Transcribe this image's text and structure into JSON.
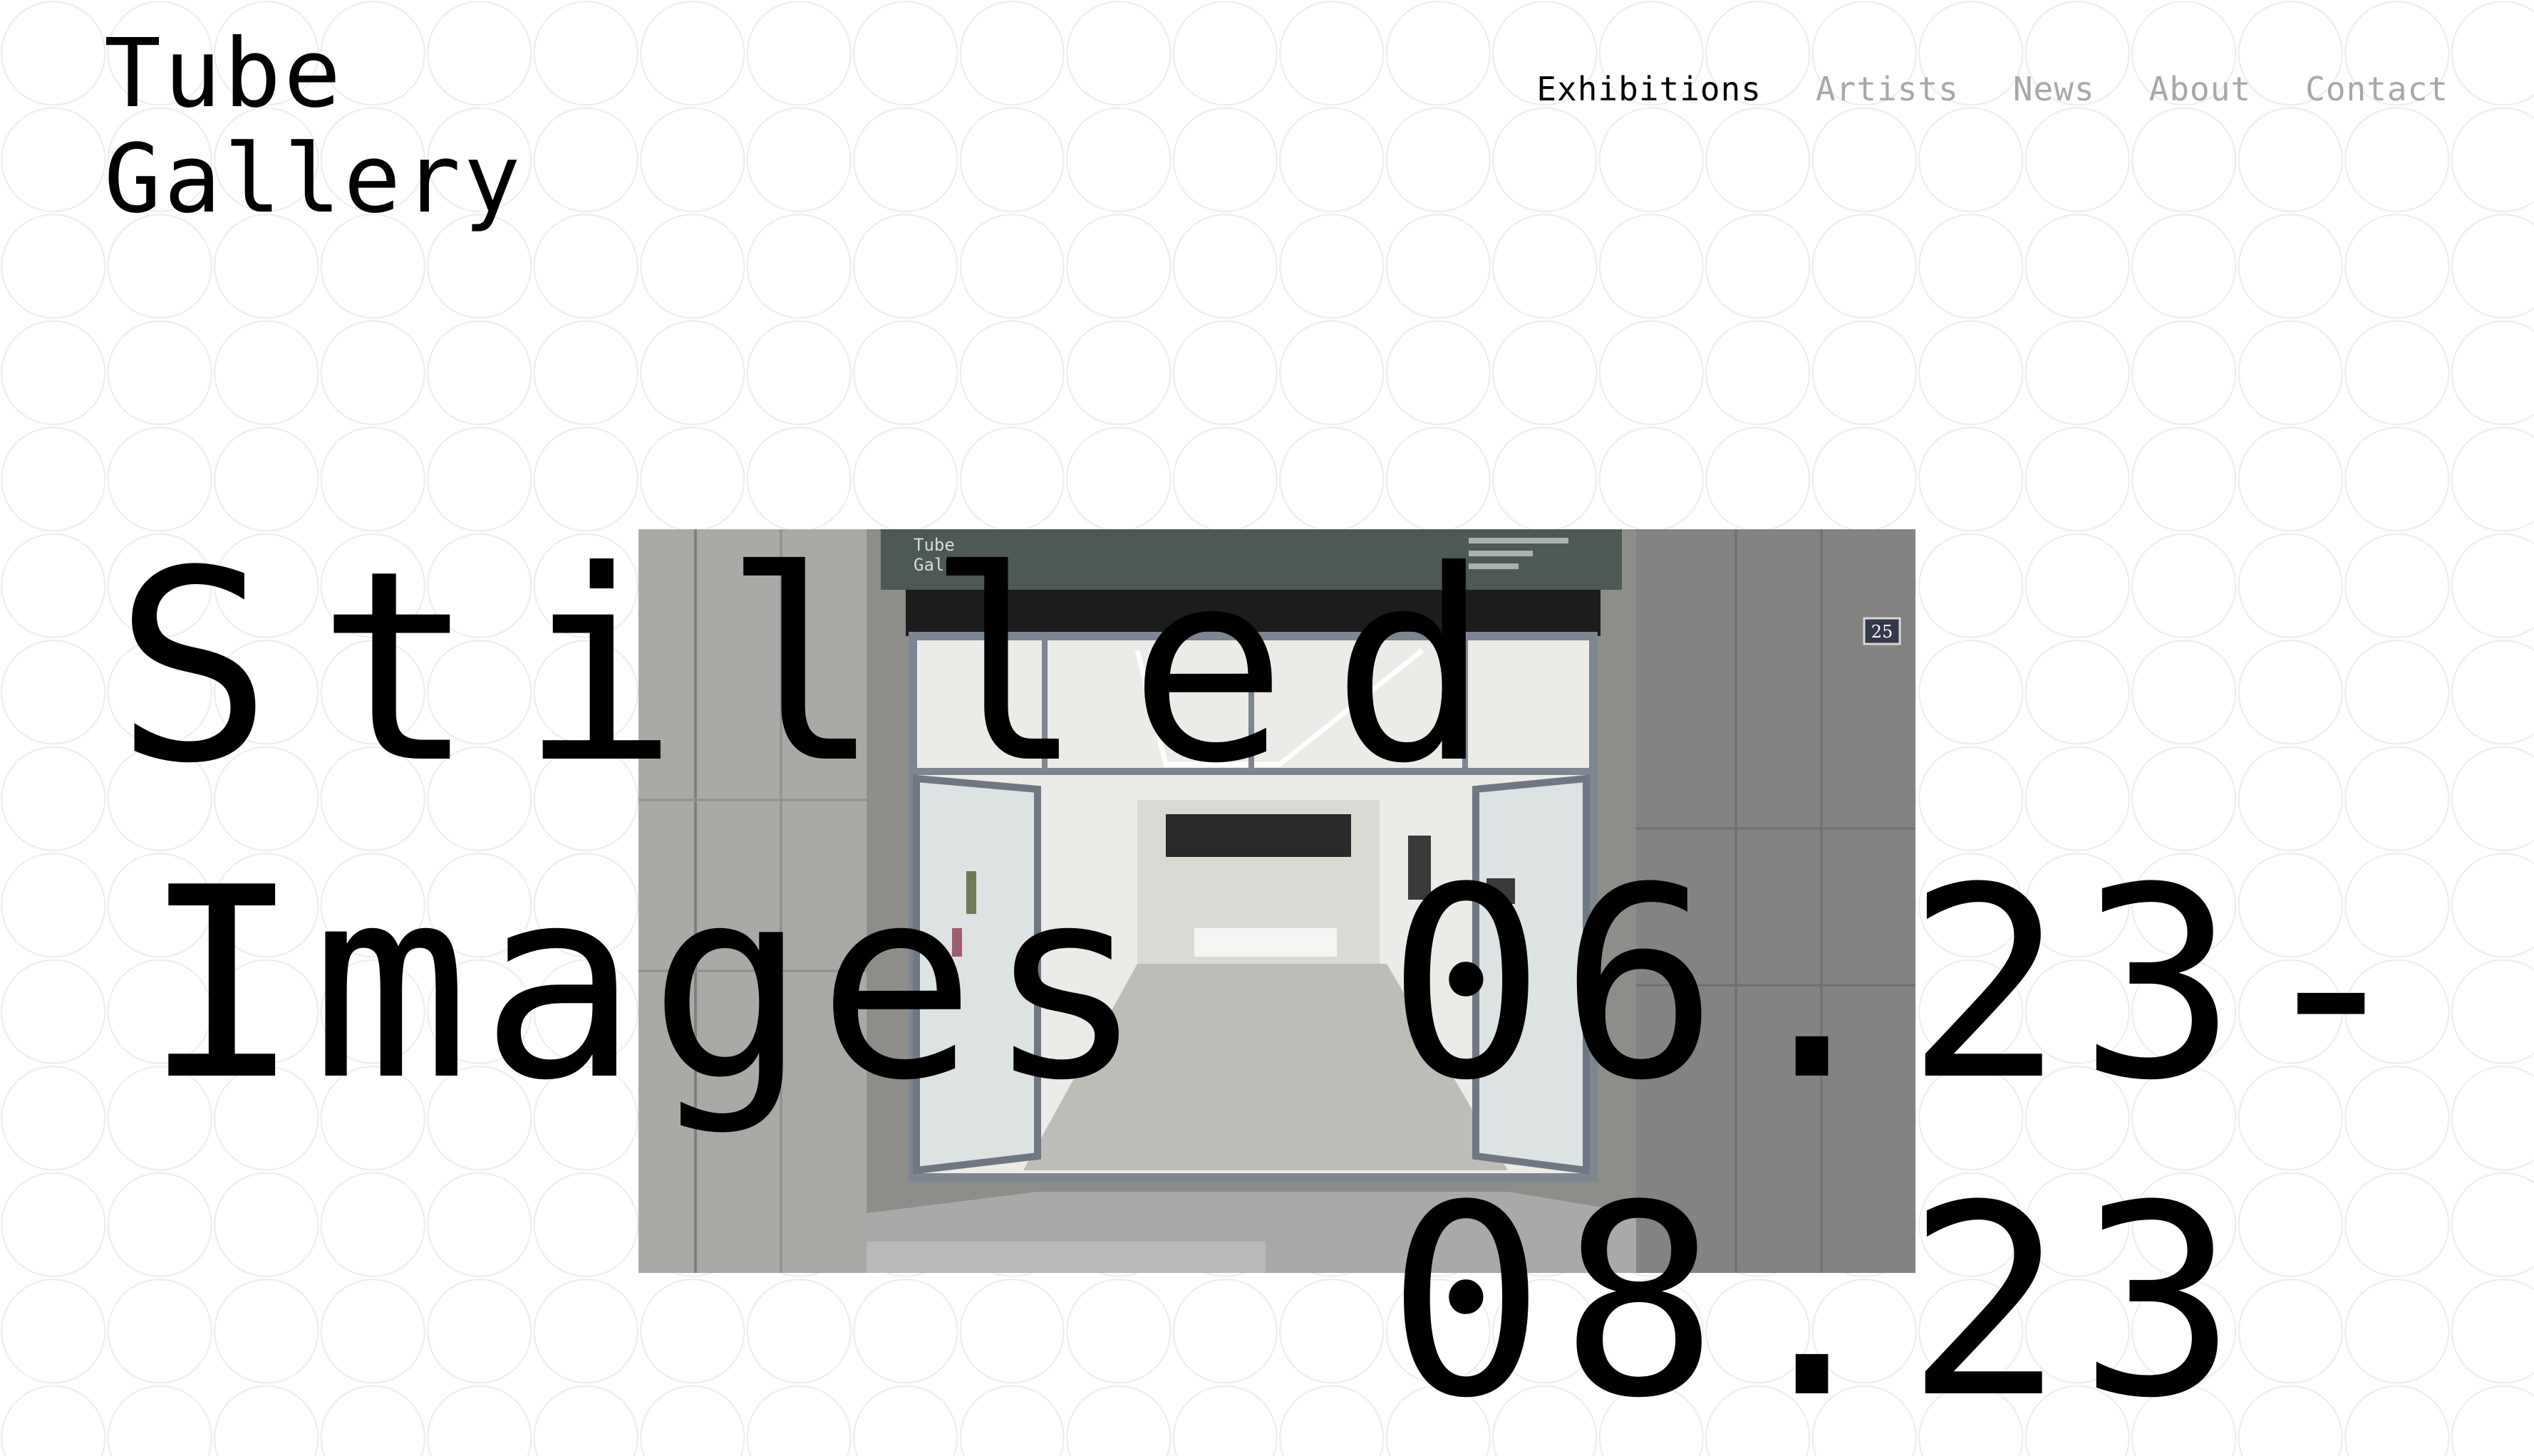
{
  "header": {
    "logo_line1": "Tube",
    "logo_line2": "Gallery"
  },
  "nav": {
    "items": [
      {
        "label": "Exhibitions",
        "active": true
      },
      {
        "label": "Artists",
        "active": false
      },
      {
        "label": "News",
        "active": false
      },
      {
        "label": "About",
        "active": false
      },
      {
        "label": "Contact",
        "active": false
      }
    ]
  },
  "exhibition": {
    "title_line1": "Stilled",
    "title_line2": "Images",
    "date_start": "06.23-",
    "date_end": "08.23",
    "photo": {
      "sign_logo_line1": "Tube",
      "sign_logo_line2": "Gallery",
      "street_number": "25"
    }
  },
  "colors": {
    "background": "#ffffff",
    "pattern_circles": "#ececec",
    "text": "#000000",
    "nav_inactive": "#a8a8a8"
  }
}
